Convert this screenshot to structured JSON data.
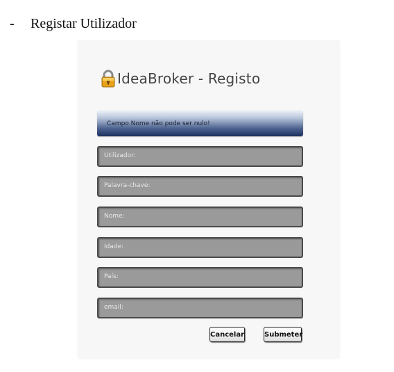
{
  "document": {
    "bullet": "-",
    "heading": "Registar Utilizador"
  },
  "app": {
    "title": "IdeaBroker - Registo",
    "title_icon": "lock-icon",
    "error_message": "Campo Nome não pode ser nulo!",
    "fields": {
      "username_placeholder": "Utilizador:",
      "password_placeholder": "Palavra-chave:",
      "name_placeholder": "Nome:",
      "age_placeholder": "Idade:",
      "country_placeholder": "País:",
      "email_placeholder": "email:"
    },
    "buttons": {
      "cancel": "Cancelar",
      "submit": "Submeter"
    },
    "colors": {
      "banner_dark": "#1c305f",
      "field_bg": "#9a9a9a",
      "lock_gold": "#e8a21a"
    }
  }
}
